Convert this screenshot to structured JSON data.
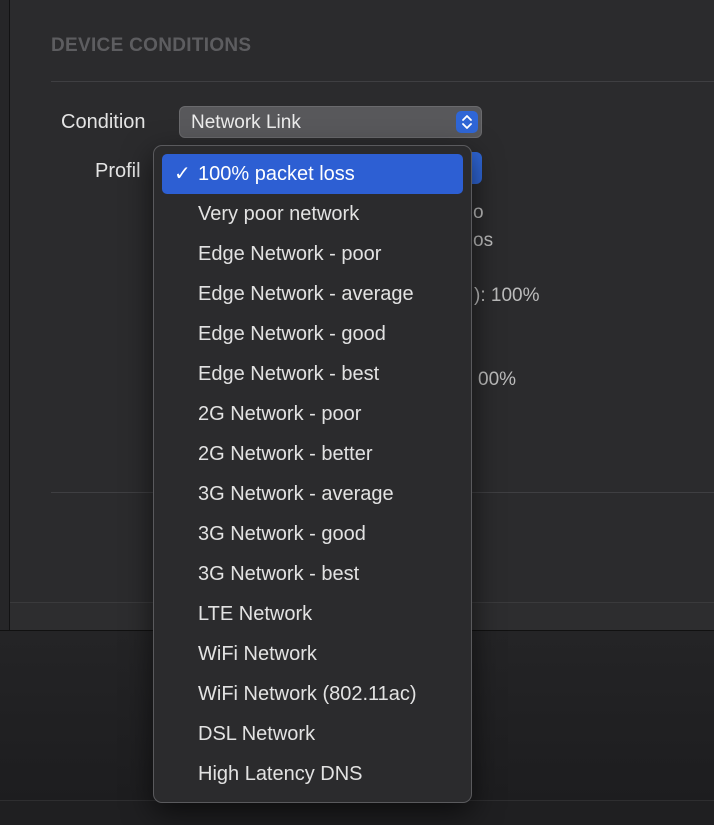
{
  "section": {
    "title": "DEVICE CONDITIONS"
  },
  "condition": {
    "label": "Condition",
    "value": "Network Link"
  },
  "profile": {
    "label": "Profil"
  },
  "partial_details": [
    {
      "text": "o"
    },
    {
      "text": "os"
    },
    {
      "text": "): 100%"
    },
    {
      "text": "00%"
    }
  ],
  "menu": {
    "check_glyph": "✓",
    "items": [
      {
        "label": "100% packet loss"
      },
      {
        "label": "Very poor network"
      },
      {
        "label": "Edge Network - poor"
      },
      {
        "label": "Edge Network - average"
      },
      {
        "label": "Edge Network - good"
      },
      {
        "label": "Edge Network - best"
      },
      {
        "label": "2G Network - poor"
      },
      {
        "label": "2G Network - better"
      },
      {
        "label": "3G Network - average"
      },
      {
        "label": "3G Network - good"
      },
      {
        "label": "3G Network - best"
      },
      {
        "label": "LTE Network"
      },
      {
        "label": "WiFi Network"
      },
      {
        "label": "WiFi Network (802.11ac)"
      },
      {
        "label": "DSL Network"
      },
      {
        "label": "High Latency DNS"
      }
    ],
    "selected_index": 0
  },
  "colors": {
    "accent": "#2d5fd3",
    "menu_bg": "#2b2b2d"
  }
}
